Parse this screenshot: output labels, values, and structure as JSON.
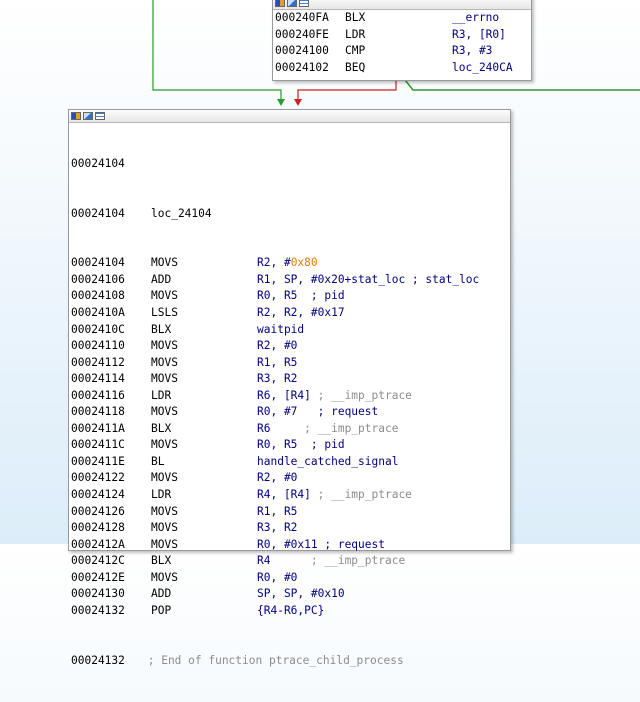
{
  "top_block": {
    "lines": [
      {
        "addr": "000240FA",
        "mn": "BLX",
        "op": "__errno"
      },
      {
        "addr": "000240FE",
        "mn": "LDR",
        "op": "R3, [R0]"
      },
      {
        "addr": "00024100",
        "mn": "CMP",
        "op": "R3, #3"
      },
      {
        "addr": "00024102",
        "mn": "BEQ",
        "op": "loc_240CA"
      }
    ]
  },
  "main_block": {
    "label_line_addr": "00024104",
    "loc_label": "loc_24104",
    "lines": [
      {
        "addr": "00024104",
        "mn": "MOVS",
        "op_a": "R2, #",
        "op_hex": "0x80",
        "op_b": "",
        "cmt": ""
      },
      {
        "addr": "00024106",
        "mn": "ADD",
        "op_a": "R1, SP, #0x20+stat_loc",
        "op_hex": "",
        "op_b": "",
        "cmt": " ; stat_loc"
      },
      {
        "addr": "00024108",
        "mn": "MOVS",
        "op_a": "R0, R5",
        "op_hex": "",
        "op_b": "",
        "cmt": "  ; pid"
      },
      {
        "addr": "0002410A",
        "mn": "LSLS",
        "op_a": "R2, R2, #0x17",
        "op_hex": "",
        "op_b": "",
        "cmt": ""
      },
      {
        "addr": "0002410C",
        "mn": "BLX",
        "op_a": "waitpid",
        "op_hex": "",
        "op_b": "",
        "cmt": ""
      },
      {
        "addr": "00024110",
        "mn": "MOVS",
        "op_a": "R2, #0",
        "op_hex": "",
        "op_b": "",
        "cmt": ""
      },
      {
        "addr": "00024112",
        "mn": "MOVS",
        "op_a": "R1, R5",
        "op_hex": "",
        "op_b": "",
        "cmt": ""
      },
      {
        "addr": "00024114",
        "mn": "MOVS",
        "op_a": "R3, R2",
        "op_hex": "",
        "op_b": "",
        "cmt": ""
      },
      {
        "addr": "00024116",
        "mn": "LDR",
        "op_a": "R6, [R4]",
        "op_hex": "",
        "op_b": "",
        "cmt": " ; __imp_ptrace"
      },
      {
        "addr": "00024118",
        "mn": "MOVS",
        "op_a": "R0, #7",
        "op_hex": "",
        "op_b": "",
        "cmt": "   ; request"
      },
      {
        "addr": "0002411A",
        "mn": "BLX",
        "op_a": "R6",
        "op_hex": "",
        "op_b": "",
        "cmt": "     ; __imp_ptrace"
      },
      {
        "addr": "0002411C",
        "mn": "MOVS",
        "op_a": "R0, R5",
        "op_hex": "",
        "op_b": "",
        "cmt": "  ; pid"
      },
      {
        "addr": "0002411E",
        "mn": "BL",
        "op_a": "handle_catched_signal",
        "op_hex": "",
        "op_b": "",
        "cmt": ""
      },
      {
        "addr": "00024122",
        "mn": "MOVS",
        "op_a": "R2, #0",
        "op_hex": "",
        "op_b": "",
        "cmt": ""
      },
      {
        "addr": "00024124",
        "mn": "LDR",
        "op_a": "R4, [R4]",
        "op_hex": "",
        "op_b": "",
        "cmt": " ; __imp_ptrace"
      },
      {
        "addr": "00024126",
        "mn": "MOVS",
        "op_a": "R1, R5",
        "op_hex": "",
        "op_b": "",
        "cmt": ""
      },
      {
        "addr": "00024128",
        "mn": "MOVS",
        "op_a": "R3, R2",
        "op_hex": "",
        "op_b": "",
        "cmt": ""
      },
      {
        "addr": "0002412A",
        "mn": "MOVS",
        "op_a": "R0, #0x11",
        "op_hex": "",
        "op_b": "",
        "cmt": " ; request"
      },
      {
        "addr": "0002412C",
        "mn": "BLX",
        "op_a": "R4",
        "op_hex": "",
        "op_b": "",
        "cmt": "      ; __imp_ptrace"
      },
      {
        "addr": "0002412E",
        "mn": "MOVS",
        "op_a": "R0, #0",
        "op_hex": "",
        "op_b": "",
        "cmt": ""
      },
      {
        "addr": "00024130",
        "mn": "ADD",
        "op_a": "SP, SP, #0x10",
        "op_hex": "",
        "op_b": "",
        "cmt": ""
      },
      {
        "addr": "00024132",
        "mn": "POP",
        "op_a": "{R4-R6,PC}",
        "op_hex": "",
        "op_b": "",
        "cmt": ""
      }
    ],
    "end_addr": "00024132",
    "end_comment": " ; End of function ptrace_child_process"
  },
  "colors": {
    "edge_true": "#2a9a2a",
    "edge_false": "#d02020",
    "edge_jump": "#2a9a2a"
  }
}
